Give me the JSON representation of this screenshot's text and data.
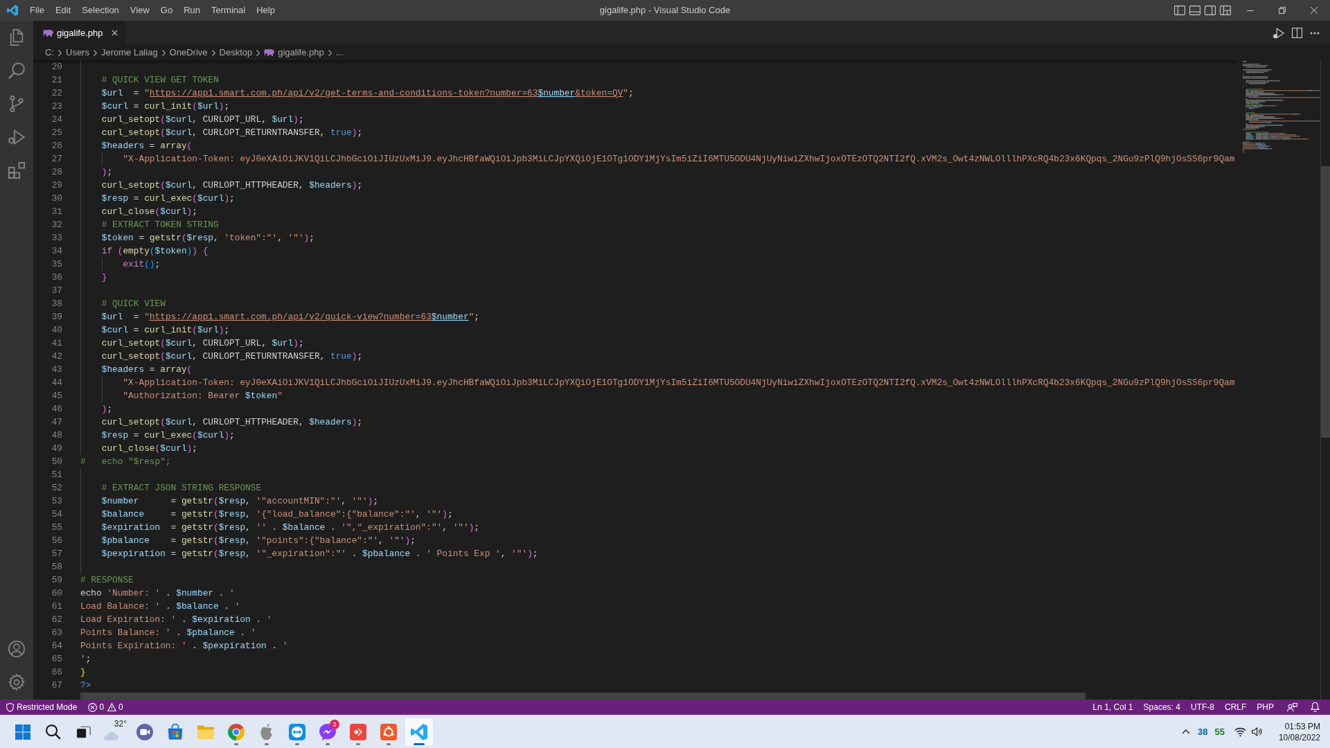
{
  "window": {
    "title": "gigalife.php - Visual Studio Code"
  },
  "menu": [
    "File",
    "Edit",
    "Selection",
    "View",
    "Go",
    "Run",
    "Terminal",
    "Help"
  ],
  "tabs": [
    {
      "label": "gigalife.php",
      "selected": true
    }
  ],
  "breadcrumbs": [
    {
      "kind": "folder",
      "text": "C:"
    },
    {
      "kind": "folder",
      "text": "Users"
    },
    {
      "kind": "folder",
      "text": "Jerome Laliag"
    },
    {
      "kind": "folder",
      "text": "OneDrive"
    },
    {
      "kind": "folder",
      "text": "Desktop"
    },
    {
      "kind": "file",
      "text": "gigalife.php"
    },
    {
      "kind": "symbol",
      "text": "..."
    }
  ],
  "editor": {
    "lines": [
      {
        "number": "20"
      },
      {
        "number": "21",
        "tokens": [
          {
            "kind": "comment",
            "text": "    # QUICK VIEW GET TOKEN"
          }
        ]
      },
      {
        "number": "22",
        "tokens": [
          {
            "kind": "variable",
            "text": "    $url"
          },
          {
            "kind": "plain",
            "text": "  = "
          },
          {
            "kind": "string",
            "text": "\""
          },
          {
            "kind": "link",
            "tokens": [
              {
                "kind": "string",
                "text": "https://app1.smart.com.ph/api/v2/get-terms-and-conditions-token?number=63"
              },
              {
                "kind": "variable",
                "text": "$number"
              },
              {
                "kind": "string",
                "text": "&token=QV"
              }
            ]
          },
          {
            "kind": "string",
            "text": "\""
          },
          {
            "kind": "plain",
            "text": ";"
          }
        ]
      },
      {
        "number": "23",
        "tokens": [
          {
            "kind": "variable",
            "text": "    $curl"
          },
          {
            "kind": "plain",
            "text": " = "
          },
          {
            "kind": "function",
            "text": "curl_init"
          },
          {
            "kind": "bracket2",
            "text": "("
          },
          {
            "kind": "variable",
            "text": "$url"
          },
          {
            "kind": "bracket2",
            "text": ")"
          },
          {
            "kind": "plain",
            "text": ";"
          }
        ]
      },
      {
        "number": "24",
        "tokens": [
          {
            "kind": "function",
            "text": "    curl_setopt"
          },
          {
            "kind": "bracket2",
            "text": "("
          },
          {
            "kind": "variable",
            "text": "$curl"
          },
          {
            "kind": "plain",
            "text": ", CURLOPT_URL, "
          },
          {
            "kind": "variable",
            "text": "$url"
          },
          {
            "kind": "bracket2",
            "text": ")"
          },
          {
            "kind": "plain",
            "text": ";"
          }
        ]
      },
      {
        "number": "25",
        "tokens": [
          {
            "kind": "function",
            "text": "    curl_setopt"
          },
          {
            "kind": "bracket2",
            "text": "("
          },
          {
            "kind": "variable",
            "text": "$curl"
          },
          {
            "kind": "plain",
            "text": ", CURLOPT_RETURNTRANSFER, "
          },
          {
            "kind": "constant",
            "text": "true"
          },
          {
            "kind": "bracket2",
            "text": ")"
          },
          {
            "kind": "plain",
            "text": ";"
          }
        ]
      },
      {
        "number": "26",
        "tokens": [
          {
            "kind": "variable",
            "text": "    $headers"
          },
          {
            "kind": "plain",
            "text": " = "
          },
          {
            "kind": "function",
            "text": "array"
          },
          {
            "kind": "bracket2",
            "text": "("
          }
        ]
      },
      {
        "number": "27",
        "tokens": [
          {
            "kind": "string",
            "text": "        \"X-Application-Token: eyJ0eXAiOiJKV1QiLCJhbGciOiJIUzUxMiJ9.eyJhcHBfaWQiOiJpb3MiLCJpYXQiOjE1OTg1ODY1MjYsIm5iZiI6MTU5ODU4NjUyNiwiZXhwIjoxOTEzOTQ2NTI2fQ.xVM2s_Owt4zNWLOlllhPXcRQ4b23x6KQpqs_2NGu9zPlQ9hjOsSS6pr9Qam"
          }
        ]
      },
      {
        "number": "28",
        "tokens": [
          {
            "kind": "bracket2",
            "text": "    )"
          },
          {
            "kind": "plain",
            "text": ";"
          }
        ]
      },
      {
        "number": "29",
        "tokens": [
          {
            "kind": "function",
            "text": "    curl_setopt"
          },
          {
            "kind": "bracket2",
            "text": "("
          },
          {
            "kind": "variable",
            "text": "$curl"
          },
          {
            "kind": "plain",
            "text": ", CURLOPT_HTTPHEADER, "
          },
          {
            "kind": "variable",
            "text": "$headers"
          },
          {
            "kind": "bracket2",
            "text": ")"
          },
          {
            "kind": "plain",
            "text": ";"
          }
        ]
      },
      {
        "number": "30",
        "tokens": [
          {
            "kind": "variable",
            "text": "    $resp"
          },
          {
            "kind": "plain",
            "text": " = "
          },
          {
            "kind": "function",
            "text": "curl_exec"
          },
          {
            "kind": "bracket2",
            "text": "("
          },
          {
            "kind": "variable",
            "text": "$curl"
          },
          {
            "kind": "bracket2",
            "text": ")"
          },
          {
            "kind": "plain",
            "text": ";"
          }
        ]
      },
      {
        "number": "31",
        "tokens": [
          {
            "kind": "function",
            "text": "    curl_close"
          },
          {
            "kind": "bracket2",
            "text": "("
          },
          {
            "kind": "variable",
            "text": "$curl"
          },
          {
            "kind": "bracket2",
            "text": ")"
          },
          {
            "kind": "plain",
            "text": ";"
          }
        ]
      },
      {
        "number": "32",
        "tokens": [
          {
            "kind": "comment",
            "text": "    # EXTRACT TOKEN STRING"
          }
        ]
      },
      {
        "number": "33",
        "tokens": [
          {
            "kind": "variable",
            "text": "    $token"
          },
          {
            "kind": "plain",
            "text": " = "
          },
          {
            "kind": "function",
            "text": "getstr"
          },
          {
            "kind": "bracket2",
            "text": "("
          },
          {
            "kind": "variable",
            "text": "$resp"
          },
          {
            "kind": "plain",
            "text": ", "
          },
          {
            "kind": "string",
            "text": "'token\":\"'"
          },
          {
            "kind": "plain",
            "text": ", "
          },
          {
            "kind": "string",
            "text": "'\"'"
          },
          {
            "kind": "bracket2",
            "text": ")"
          },
          {
            "kind": "plain",
            "text": ";"
          }
        ]
      },
      {
        "number": "34",
        "tokens": [
          {
            "kind": "keyword",
            "text": "    if"
          },
          {
            "kind": "bracket2",
            "text": " ("
          },
          {
            "kind": "function",
            "text": "empty"
          },
          {
            "kind": "bracket3",
            "text": "("
          },
          {
            "kind": "variable",
            "text": "$token"
          },
          {
            "kind": "bracket3",
            "text": ")"
          },
          {
            "kind": "bracket2",
            "text": ") {"
          }
        ]
      },
      {
        "number": "35",
        "tokens": [
          {
            "kind": "keyword",
            "text": "        exit"
          },
          {
            "kind": "bracket3",
            "text": "()"
          },
          {
            "kind": "plain",
            "text": ";"
          }
        ]
      },
      {
        "number": "36",
        "tokens": [
          {
            "kind": "bracket2",
            "text": "    }"
          }
        ]
      },
      {
        "number": "37"
      },
      {
        "number": "38",
        "tokens": [
          {
            "kind": "comment",
            "text": "    # QUICK VIEW"
          }
        ]
      },
      {
        "number": "39",
        "tokens": [
          {
            "kind": "variable",
            "text": "    $url"
          },
          {
            "kind": "plain",
            "text": "  = "
          },
          {
            "kind": "string",
            "text": "\""
          },
          {
            "kind": "link",
            "tokens": [
              {
                "kind": "string",
                "text": "https://app1.smart.com.ph/api/v2/quick-view?number=63"
              },
              {
                "kind": "variable",
                "text": "$number"
              }
            ]
          },
          {
            "kind": "string",
            "text": "\""
          },
          {
            "kind": "plain",
            "text": ";"
          }
        ]
      },
      {
        "number": "40",
        "tokens": [
          {
            "kind": "variable",
            "text": "    $curl"
          },
          {
            "kind": "plain",
            "text": " = "
          },
          {
            "kind": "function",
            "text": "curl_init"
          },
          {
            "kind": "bracket2",
            "text": "("
          },
          {
            "kind": "variable",
            "text": "$url"
          },
          {
            "kind": "bracket2",
            "text": ")"
          },
          {
            "kind": "plain",
            "text": ";"
          }
        ]
      },
      {
        "number": "41",
        "tokens": [
          {
            "kind": "function",
            "text": "    curl_setopt"
          },
          {
            "kind": "bracket2",
            "text": "("
          },
          {
            "kind": "variable",
            "text": "$curl"
          },
          {
            "kind": "plain",
            "text": ", CURLOPT_URL, "
          },
          {
            "kind": "variable",
            "text": "$url"
          },
          {
            "kind": "bracket2",
            "text": ")"
          },
          {
            "kind": "plain",
            "text": ";"
          }
        ]
      },
      {
        "number": "42",
        "tokens": [
          {
            "kind": "function",
            "text": "    curl_setopt"
          },
          {
            "kind": "bracket2",
            "text": "("
          },
          {
            "kind": "variable",
            "text": "$curl"
          },
          {
            "kind": "plain",
            "text": ", CURLOPT_RETURNTRANSFER, "
          },
          {
            "kind": "constant",
            "text": "true"
          },
          {
            "kind": "bracket2",
            "text": ")"
          },
          {
            "kind": "plain",
            "text": ";"
          }
        ]
      },
      {
        "number": "43",
        "tokens": [
          {
            "kind": "variable",
            "text": "    $headers"
          },
          {
            "kind": "plain",
            "text": " = "
          },
          {
            "kind": "function",
            "text": "array"
          },
          {
            "kind": "bracket2",
            "text": "("
          }
        ]
      },
      {
        "number": "44",
        "tokens": [
          {
            "kind": "string",
            "text": "        \"X-Application-Token: eyJ0eXAiOiJKV1QiLCJhbGciOiJIUzUxMiJ9.eyJhcHBfaWQiOiJpb3MiLCJpYXQiOjE1OTg1ODY1MjYsIm5iZiI6MTU5ODU4NjUyNiwiZXhwIjoxOTEzOTQ2NTI2fQ.xVM2s_Owt4zNWLOlllhPXcRQ4b23x6KQpqs_2NGu9zPlQ9hjOsSS6pr9Qam"
          }
        ]
      },
      {
        "number": "45",
        "tokens": [
          {
            "kind": "string",
            "text": "        \"Authorization: Bearer "
          },
          {
            "kind": "variable",
            "text": "$token"
          },
          {
            "kind": "string",
            "text": "\""
          }
        ]
      },
      {
        "number": "46",
        "tokens": [
          {
            "kind": "bracket2",
            "text": "    )"
          },
          {
            "kind": "plain",
            "text": ";"
          }
        ]
      },
      {
        "number": "47",
        "tokens": [
          {
            "kind": "function",
            "text": "    curl_setopt"
          },
          {
            "kind": "bracket2",
            "text": "("
          },
          {
            "kind": "variable",
            "text": "$curl"
          },
          {
            "kind": "plain",
            "text": ", CURLOPT_HTTPHEADER, "
          },
          {
            "kind": "variable",
            "text": "$headers"
          },
          {
            "kind": "bracket2",
            "text": ")"
          },
          {
            "kind": "plain",
            "text": ";"
          }
        ]
      },
      {
        "number": "48",
        "tokens": [
          {
            "kind": "variable",
            "text": "    $resp"
          },
          {
            "kind": "plain",
            "text": " = "
          },
          {
            "kind": "function",
            "text": "curl_exec"
          },
          {
            "kind": "bracket2",
            "text": "("
          },
          {
            "kind": "variable",
            "text": "$curl"
          },
          {
            "kind": "bracket2",
            "text": ")"
          },
          {
            "kind": "plain",
            "text": ";"
          }
        ]
      },
      {
        "number": "49",
        "tokens": [
          {
            "kind": "function",
            "text": "    curl_close"
          },
          {
            "kind": "bracket2",
            "text": "("
          },
          {
            "kind": "variable",
            "text": "$curl"
          },
          {
            "kind": "bracket2",
            "text": ")"
          },
          {
            "kind": "plain",
            "text": ";"
          }
        ]
      },
      {
        "number": "50",
        "tokens": [
          {
            "kind": "comment",
            "text": "#   echo \"$resp\";"
          }
        ]
      },
      {
        "number": "51"
      },
      {
        "number": "52",
        "tokens": [
          {
            "kind": "comment",
            "text": "    # EXTRACT JSON STRING RESPONSE"
          }
        ]
      },
      {
        "number": "53",
        "tokens": [
          {
            "kind": "variable",
            "text": "    $number"
          },
          {
            "kind": "plain",
            "text": "      = "
          },
          {
            "kind": "function",
            "text": "getstr"
          },
          {
            "kind": "bracket2",
            "text": "("
          },
          {
            "kind": "variable",
            "text": "$resp"
          },
          {
            "kind": "plain",
            "text": ", "
          },
          {
            "kind": "string",
            "text": "'\"accountMIN\":\"'"
          },
          {
            "kind": "plain",
            "text": ", "
          },
          {
            "kind": "string",
            "text": "'\"'"
          },
          {
            "kind": "bracket2",
            "text": ")"
          },
          {
            "kind": "plain",
            "text": ";"
          }
        ]
      },
      {
        "number": "54",
        "tokens": [
          {
            "kind": "variable",
            "text": "    $balance"
          },
          {
            "kind": "plain",
            "text": "     = "
          },
          {
            "kind": "function",
            "text": "getstr"
          },
          {
            "kind": "bracket2",
            "text": "("
          },
          {
            "kind": "variable",
            "text": "$resp"
          },
          {
            "kind": "plain",
            "text": ", "
          },
          {
            "kind": "string",
            "text": "'{\"load_balance\":{\"balance\":\"'"
          },
          {
            "kind": "plain",
            "text": ", "
          },
          {
            "kind": "string",
            "text": "'\"'"
          },
          {
            "kind": "bracket2",
            "text": ")"
          },
          {
            "kind": "plain",
            "text": ";"
          }
        ]
      },
      {
        "number": "55",
        "tokens": [
          {
            "kind": "variable",
            "text": "    $expiration"
          },
          {
            "kind": "plain",
            "text": "  = "
          },
          {
            "kind": "function",
            "text": "getstr"
          },
          {
            "kind": "bracket2",
            "text": "("
          },
          {
            "kind": "variable",
            "text": "$resp"
          },
          {
            "kind": "plain",
            "text": ", "
          },
          {
            "kind": "string",
            "text": "''"
          },
          {
            "kind": "plain",
            "text": " . "
          },
          {
            "kind": "variable",
            "text": "$balance"
          },
          {
            "kind": "plain",
            "text": " . "
          },
          {
            "kind": "string",
            "text": "'\",\"_expiration\":\"'"
          },
          {
            "kind": "plain",
            "text": ", "
          },
          {
            "kind": "string",
            "text": "'\"'"
          },
          {
            "kind": "bracket2",
            "text": ")"
          },
          {
            "kind": "plain",
            "text": ";"
          }
        ]
      },
      {
        "number": "56",
        "tokens": [
          {
            "kind": "variable",
            "text": "    $pbalance"
          },
          {
            "kind": "plain",
            "text": "    = "
          },
          {
            "kind": "function",
            "text": "getstr"
          },
          {
            "kind": "bracket2",
            "text": "("
          },
          {
            "kind": "variable",
            "text": "$resp"
          },
          {
            "kind": "plain",
            "text": ", "
          },
          {
            "kind": "string",
            "text": "'\"points\":{\"balance\":\"'"
          },
          {
            "kind": "plain",
            "text": ", "
          },
          {
            "kind": "string",
            "text": "'\"'"
          },
          {
            "kind": "bracket2",
            "text": ")"
          },
          {
            "kind": "plain",
            "text": ";"
          }
        ]
      },
      {
        "number": "57",
        "tokens": [
          {
            "kind": "variable",
            "text": "    $pexpiration"
          },
          {
            "kind": "plain",
            "text": " = "
          },
          {
            "kind": "function",
            "text": "getstr"
          },
          {
            "kind": "bracket2",
            "text": "("
          },
          {
            "kind": "variable",
            "text": "$resp"
          },
          {
            "kind": "plain",
            "text": ", "
          },
          {
            "kind": "string",
            "text": "'\"_expiration\":\"'"
          },
          {
            "kind": "plain",
            "text": " . "
          },
          {
            "kind": "variable",
            "text": "$pbalance"
          },
          {
            "kind": "plain",
            "text": " . "
          },
          {
            "kind": "string",
            "text": "' Points Exp '"
          },
          {
            "kind": "plain",
            "text": ", "
          },
          {
            "kind": "string",
            "text": "'\"'"
          },
          {
            "kind": "bracket2",
            "text": ")"
          },
          {
            "kind": "plain",
            "text": ";"
          }
        ]
      },
      {
        "number": "58"
      },
      {
        "number": "59",
        "tokens": [
          {
            "kind": "comment",
            "text": "# RESPONSE"
          }
        ]
      },
      {
        "number": "60",
        "tokens": [
          {
            "kind": "plain",
            "text": "echo "
          },
          {
            "kind": "string",
            "text": "'Number: '"
          },
          {
            "kind": "plain",
            "text": " . "
          },
          {
            "kind": "variable",
            "text": "$number"
          },
          {
            "kind": "plain",
            "text": " . "
          },
          {
            "kind": "string",
            "text": "'"
          }
        ]
      },
      {
        "number": "61",
        "tokens": [
          {
            "kind": "string",
            "text": "Load Balance: '"
          },
          {
            "kind": "plain",
            "text": " . "
          },
          {
            "kind": "variable",
            "text": "$balance"
          },
          {
            "kind": "plain",
            "text": " . "
          },
          {
            "kind": "string",
            "text": "'"
          }
        ]
      },
      {
        "number": "62",
        "tokens": [
          {
            "kind": "string",
            "text": "Load Expiration: '"
          },
          {
            "kind": "plain",
            "text": " . "
          },
          {
            "kind": "variable",
            "text": "$expiration"
          },
          {
            "kind": "plain",
            "text": " . "
          },
          {
            "kind": "string",
            "text": "'"
          }
        ]
      },
      {
        "number": "63",
        "tokens": [
          {
            "kind": "string",
            "text": "Points Balance: '"
          },
          {
            "kind": "plain",
            "text": " . "
          },
          {
            "kind": "variable",
            "text": "$pbalance"
          },
          {
            "kind": "plain",
            "text": " . "
          },
          {
            "kind": "string",
            "text": "'"
          }
        ]
      },
      {
        "number": "64",
        "tokens": [
          {
            "kind": "string",
            "text": "Points Expiration: '"
          },
          {
            "kind": "plain",
            "text": " . "
          },
          {
            "kind": "variable",
            "text": "$pexpiration"
          },
          {
            "kind": "plain",
            "text": " . "
          },
          {
            "kind": "string",
            "text": "'"
          }
        ]
      },
      {
        "number": "65",
        "tokens": [
          {
            "kind": "string",
            "text": "'"
          },
          {
            "kind": "plain",
            "text": ";"
          }
        ]
      },
      {
        "number": "66",
        "tokens": [
          {
            "kind": "bracket1",
            "text": "}"
          }
        ]
      },
      {
        "number": "67",
        "tokens": [
          {
            "kind": "tag",
            "text": "?>"
          }
        ]
      }
    ]
  },
  "status_bar": {
    "mode": "Restricted Mode",
    "errors": "0",
    "warnings": "0",
    "items": [
      "Ln 1, Col 1",
      "Spaces: 4",
      "UTF-8",
      "CRLF",
      "PHP"
    ]
  },
  "taskbar": {
    "items": [
      {
        "kind": "start",
        "running": false,
        "selected": false
      },
      {
        "kind": "search",
        "running": false,
        "selected": false
      },
      {
        "kind": "taskview",
        "running": false,
        "selected": false
      },
      {
        "kind": "weather",
        "label": "32°",
        "running": false,
        "selected": false
      },
      {
        "kind": "chat",
        "running": false,
        "selected": false
      },
      {
        "kind": "store",
        "running": false,
        "selected": false
      },
      {
        "kind": "folder",
        "running": false,
        "selected": false
      },
      {
        "kind": "ring",
        "running": true,
        "selected": false
      },
      {
        "kind": "apple",
        "running": true,
        "selected": false
      },
      {
        "kind": "arrows",
        "running": true,
        "selected": false
      },
      {
        "kind": "bubble",
        "badge": "3",
        "running": true,
        "selected": false
      },
      {
        "kind": "diamond",
        "running": true,
        "selected": false
      },
      {
        "kind": "ringtile",
        "running": true,
        "selected": false
      },
      {
        "kind": "editor",
        "running": true,
        "selected": true
      }
    ],
    "tray": {
      "readings": [
        {
          "text": "38",
          "color": "#0063b1"
        },
        {
          "text": "55",
          "color": "#107c10"
        }
      ],
      "time": "01:53 PM",
      "date": "10/08/2022"
    }
  }
}
